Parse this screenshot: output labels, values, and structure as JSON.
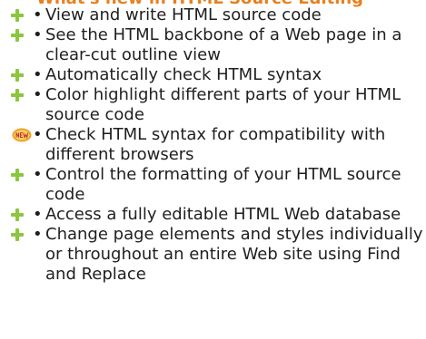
{
  "heading": "What's new in HTML Source Editing",
  "bullet_char": "•",
  "items": [
    {
      "icon": "plus-icon",
      "text": "View and write HTML source code"
    },
    {
      "icon": "plus-icon",
      "text": "See the HTML backbone of a Web page in a clear-cut outline view"
    },
    {
      "icon": "plus-icon",
      "text": "Automatically check HTML syntax"
    },
    {
      "icon": "plus-icon",
      "text": "Color highlight different parts of your HTML source code"
    },
    {
      "icon": "new-badge-icon",
      "text": "Check HTML syntax for compatibility with different browsers"
    },
    {
      "icon": "plus-icon",
      "text": "Control the formatting of your HTML source code"
    },
    {
      "icon": "plus-icon",
      "text": "Access a fully editable HTML Web database"
    },
    {
      "icon": "plus-icon",
      "text": "Change page elements and styles individually or throughout an entire Web site using Find and Replace"
    }
  ],
  "colors": {
    "plus": "#8cc63f",
    "heading": "#e8801e",
    "badge": "#f0a020"
  }
}
